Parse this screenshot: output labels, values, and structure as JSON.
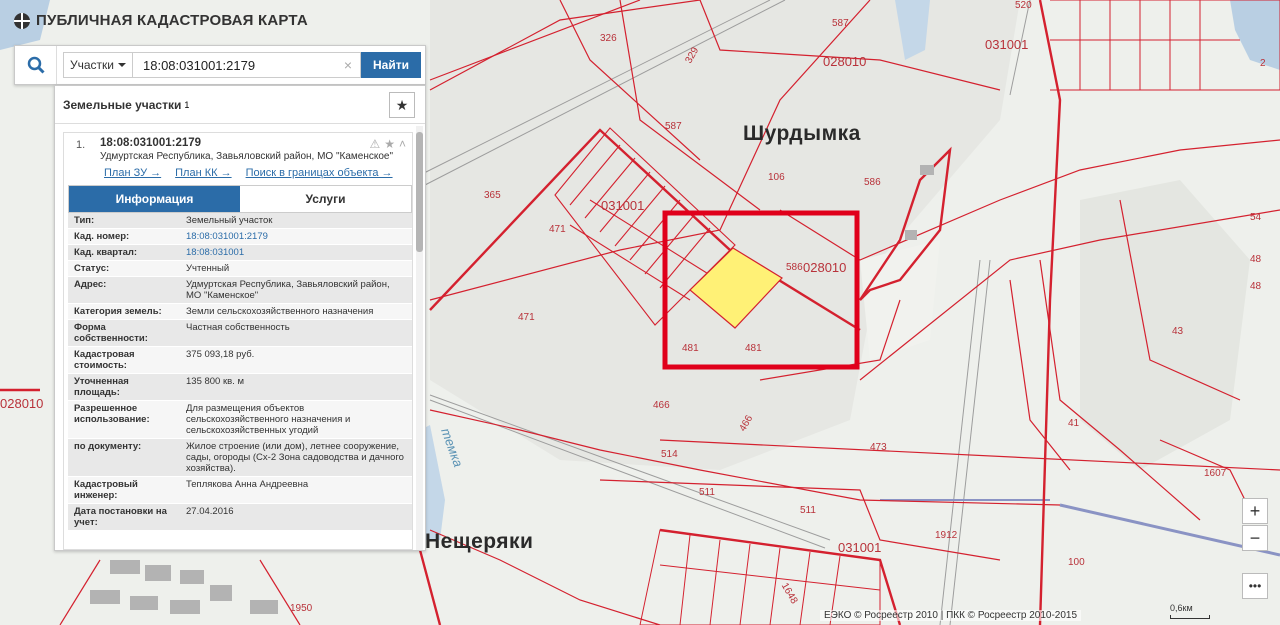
{
  "app": {
    "title": "ПУБЛИЧНАЯ КАДАСТРОВАЯ КАРТА"
  },
  "search": {
    "type_label": "Участки",
    "query": "18:08:031001:2179",
    "find_label": "Найти"
  },
  "panel": {
    "title": "Земельные участки",
    "count": "1",
    "result": {
      "number": "1.",
      "cad_number": "18:08:031001:2179",
      "address": "Удмуртская Республика, Завьяловский район, МО \"Каменское\"",
      "links": [
        "План ЗУ →",
        "План КК →",
        "Поиск в границах объекта →"
      ]
    },
    "tabs": [
      {
        "label": "Информация",
        "active": true
      },
      {
        "label": "Услуги",
        "active": false
      }
    ],
    "info": [
      {
        "k": "Тип:",
        "v": "Земельный участок"
      },
      {
        "k": "Кад. номер:",
        "v": "18:08:031001:2179"
      },
      {
        "k": "Кад. квартал:",
        "v": "18:08:031001"
      },
      {
        "k": "Статус:",
        "v": "Учтенный"
      },
      {
        "k": "Адрес:",
        "v": "Удмуртская Республика, Завьяловский район, МО \"Каменское\""
      },
      {
        "k": "Категория земель:",
        "v": "Земли сельскохозяйственного назначения"
      },
      {
        "k": "Форма собственности:",
        "v": "Частная собственность"
      },
      {
        "k": "Кадастровая стоимость:",
        "v": "375 093,18 руб."
      },
      {
        "k": "Уточненная площадь:",
        "v": "135 800 кв. м"
      },
      {
        "k": "Разрешенное использование:",
        "v": "Для размещения объектов сельскохозяйственного назначения и сельскохозяйственных угодий"
      },
      {
        "k": "по документу:",
        "v": "Жилое строение (или дом), летнее сооружение, сады, огороды (Сх-2 Зона садоводства и дачного хозяйства)."
      },
      {
        "k": "Кадастровый инженер:",
        "v": "Теплякова Анна Андреевна"
      },
      {
        "k": "Дата постановки на учет:",
        "v": "27.04.2016"
      }
    ]
  },
  "map": {
    "places": [
      "Шурдымка",
      "Нещеряки",
      "темка"
    ],
    "labels": [
      "326",
      "329",
      "587",
      "587",
      "028010",
      "031001",
      "106",
      "586",
      "365",
      "471",
      "031001",
      "586",
      "028010",
      "471",
      "481",
      "481",
      "466",
      "466",
      "473",
      "514",
      "511",
      "511",
      "031001",
      "1912",
      "1950",
      "028010",
      "43",
      "48",
      "48",
      "41",
      "1607",
      "100",
      "54",
      "520",
      "2",
      "1648"
    ]
  },
  "controls": {
    "zoom_in": "+",
    "zoom_out": "−",
    "more": "•••"
  },
  "attribution": "ЕЭКО © Росреестр 2010 | ПКК © Росреестр 2010-2015",
  "scale": "0,6км",
  "colors": {
    "accent": "#2b6ca8",
    "boundary": "#d4212f",
    "parcel_fill": "#fff176",
    "highlight": "#e0001b"
  }
}
